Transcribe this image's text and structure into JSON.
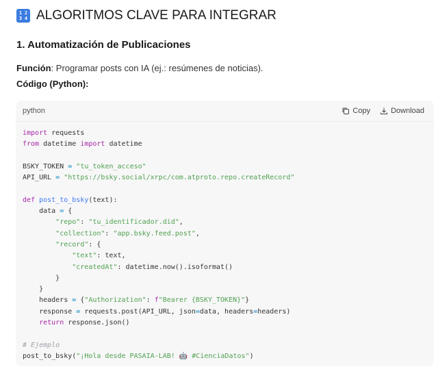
{
  "heading": {
    "icon_text": [
      "1",
      "2",
      "3",
      "4"
    ],
    "title": "ALGORITMOS CLAVE PARA INTEGRAR"
  },
  "section": {
    "title": "1. Automatización de Publicaciones",
    "function_label": "Función",
    "function_text": ": Programar posts con IA (ej.: resúmenes de noticias).",
    "code_label": "Código (Python):"
  },
  "code_block": {
    "language": "python",
    "copy_label": "Copy",
    "download_label": "Download",
    "lines": [
      "import requests",
      "from datetime import datetime",
      "",
      "BSKY_TOKEN = \"tu_token_acceso\"",
      "API_URL = \"https://bsky.social/xrpc/com.atproto.repo.createRecord\"",
      "",
      "def post_to_bsky(text):",
      "    data = {",
      "        \"repo\": \"tu_identificador.did\",",
      "        \"collection\": \"app.bsky.feed.post\",",
      "        \"record\": {",
      "            \"text\": text,",
      "            \"createdAt\": datetime.now().isoformat()",
      "        }",
      "    }",
      "    headers = {\"Authorization\": f\"Bearer {BSKY_TOKEN}\"}",
      "    response = requests.post(API_URL, json=data, headers=headers)",
      "    return response.json()",
      "",
      "# Ejemplo",
      "post_to_bsky(\"¡Hola desde PASAIA-LAB! 🤖 #CienciaDatos\")"
    ]
  },
  "colors": {
    "keyword": "#a626a4",
    "string": "#50a14f",
    "function": "#4078f2",
    "comment": "#a0a1a7",
    "code_background": "#f7f7f8"
  }
}
